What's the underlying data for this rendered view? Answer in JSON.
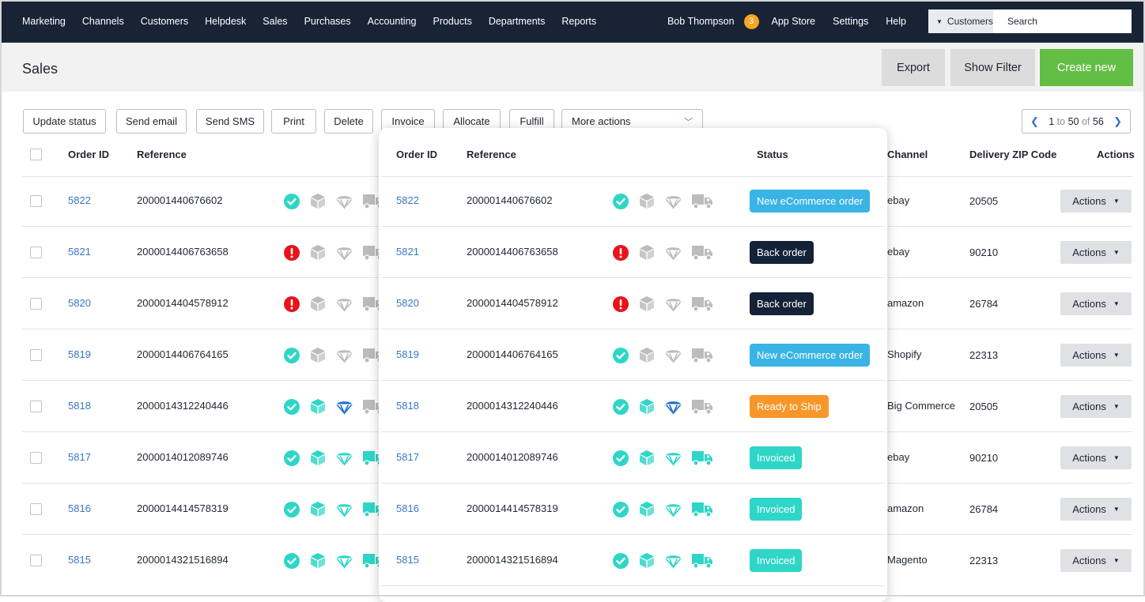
{
  "nav": {
    "items": [
      "Marketing",
      "Channels",
      "Customers",
      "Helpdesk",
      "Sales",
      "Purchases",
      "Accounting",
      "Products",
      "Departments",
      "Reports"
    ],
    "user": "Bob Thompson",
    "notifications": "3",
    "app_store": "App Store",
    "settings": "Settings",
    "help": "Help",
    "search_scope": "Customers",
    "search_placeholder": "Search"
  },
  "page": {
    "title": "Sales",
    "export": "Export",
    "show_filter": "Show Filter",
    "create_new": "Create new"
  },
  "toolbar": {
    "update_status": "Update status",
    "send_email": "Send email",
    "send_sms": "Send SMS",
    "print": "Print",
    "delete": "Delete",
    "invoice": "Invoice",
    "allocate": "Allocate",
    "fulfill": "Fulfill",
    "more_actions": "More actions"
  },
  "pager": {
    "from": "1",
    "to_word": "to",
    "to": "50",
    "of_word": "of",
    "total": "56"
  },
  "columns": {
    "order_id": "Order ID",
    "reference": "Reference",
    "status": "Status",
    "channel": "Channel",
    "delivery_zip": "Delivery ZIP Code",
    "actions": "Actions"
  },
  "action_label": "Actions",
  "status_colors": {
    "New eCommerce order": "#3ab4e5",
    "Back order": "#142238",
    "Ready to Ship": "#f7972a",
    "Invoiced": "#2fd6c7"
  },
  "rows": [
    {
      "id": "5822",
      "ref": "200001440676602",
      "icons": [
        "ok",
        "grey",
        "grey",
        "grey"
      ],
      "status": "New eCommerce order",
      "channel": "ebay",
      "zip": "20505"
    },
    {
      "id": "5821",
      "ref": "2000014406763658",
      "icons": [
        "err",
        "grey",
        "grey",
        "grey"
      ],
      "status": "Back order",
      "channel": "ebay",
      "zip": "90210"
    },
    {
      "id": "5820",
      "ref": "2000014404578912",
      "icons": [
        "err",
        "grey",
        "grey",
        "grey"
      ],
      "status": "Back order",
      "channel": "amazon",
      "zip": "26784"
    },
    {
      "id": "5819",
      "ref": "2000014406764165",
      "icons": [
        "ok",
        "grey",
        "grey",
        "grey"
      ],
      "status": "New eCommerce order",
      "channel": "Shopify",
      "zip": "22313"
    },
    {
      "id": "5818",
      "ref": "2000014312240446",
      "icons": [
        "ok",
        "teal",
        "blue",
        "grey"
      ],
      "status": "Ready to Ship",
      "channel": "Big Commerce",
      "zip": "20505"
    },
    {
      "id": "5817",
      "ref": "2000014012089746",
      "icons": [
        "ok",
        "teal",
        "teal",
        "teal"
      ],
      "status": "Invoiced",
      "channel": "ebay",
      "zip": "90210"
    },
    {
      "id": "5816",
      "ref": "2000014414578319",
      "icons": [
        "ok",
        "teal",
        "teal",
        "teal"
      ],
      "status": "Invoiced",
      "channel": "amazon",
      "zip": "26784"
    },
    {
      "id": "5815",
      "ref": "2000014321516894",
      "icons": [
        "ok",
        "teal",
        "teal",
        "teal"
      ],
      "status": "Invoiced",
      "channel": "Magento",
      "zip": "22313"
    }
  ]
}
